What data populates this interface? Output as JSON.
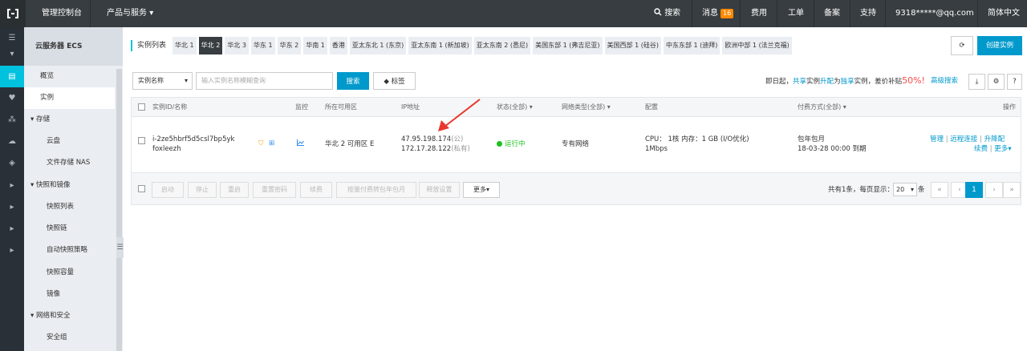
{
  "topbar": {
    "console": "管理控制台",
    "products": "产品与服务",
    "search": "搜索",
    "messages": "消息",
    "message_count": "16",
    "billing": "费用",
    "tickets": "工单",
    "icp": "备案",
    "support": "支持",
    "account": "9318*****@qq.com",
    "language": "简体中文"
  },
  "sidebar": {
    "title": "云服务器 ECS",
    "items": [
      {
        "label": "概览"
      },
      {
        "label": "实例"
      },
      {
        "label": "存储"
      },
      {
        "label": "云盘"
      },
      {
        "label": "文件存储 NAS"
      },
      {
        "label": "快照和镜像"
      },
      {
        "label": "快照列表"
      },
      {
        "label": "快照链"
      },
      {
        "label": "自动快照策略"
      },
      {
        "label": "快照容量"
      },
      {
        "label": "镜像"
      },
      {
        "label": "网络和安全"
      },
      {
        "label": "安全组"
      }
    ]
  },
  "regions": {
    "label": "实例列表",
    "tabs": [
      {
        "label": "华北 1"
      },
      {
        "label": "华北 2"
      },
      {
        "label": "华北 3"
      },
      {
        "label": "华东 1"
      },
      {
        "label": "华东 2"
      },
      {
        "label": "华南 1"
      },
      {
        "label": "香港"
      },
      {
        "label": "亚太东北 1 (东京)"
      },
      {
        "label": "亚太东南 1 (新加坡)"
      },
      {
        "label": "亚太东南 2 (悉尼)"
      },
      {
        "label": "美国东部 1 (弗吉尼亚)"
      },
      {
        "label": "美国西部 1 (硅谷)"
      },
      {
        "label": "中东东部 1 (迪拜)"
      },
      {
        "label": "欧洲中部 1 (法兰克福)"
      }
    ],
    "active_index": 1
  },
  "toolbar": {
    "create": "创建实例"
  },
  "filter": {
    "select_value": "实例名称",
    "search_placeholder": "输入实例名称模糊查询",
    "search_button": "搜索",
    "tag_button": "标签",
    "promo_prefix": "即日起，",
    "promo_share": "共享",
    "promo_mid1": "实例",
    "promo_upgrade": "升配",
    "promo_mid2": "为",
    "promo_exclusive": "独享",
    "promo_mid3": "实例，差价补贴",
    "promo_percent": "50%!",
    "advanced_search": "高级搜索"
  },
  "table": {
    "headers": {
      "id_name": "实例ID/名称",
      "monitor": "监控",
      "zone": "所在可用区",
      "ip": "IP地址",
      "status": "状态(全部)",
      "network": "网络类型(全部)",
      "config": "配置",
      "billing": "付费方式(全部)",
      "actions": "操作"
    },
    "rows": [
      {
        "instance_id": "i-2ze5hbrf5d5csl7bp5yk",
        "name": "foxleezh",
        "zone": "华北 2 可用区 E",
        "public_ip": "47.95.198.174",
        "public_tag": "(公)",
        "private_ip": "172.17.28.122",
        "private_tag": "(私有)",
        "status": "运行中",
        "network": "专有网络",
        "config_line1": "CPU： 1核    内存：1 GB (I/O优化)",
        "config_line2": "1Mbps",
        "billing_type": "包年包月",
        "expiry": "18-03-28 00:00 到期",
        "actions": {
          "manage": "管理",
          "remote": "远程连接",
          "upgrade": "升降配",
          "renew": "续费",
          "more": "更多"
        }
      }
    ],
    "batch": {
      "start": "启动",
      "stop": "停止",
      "restart": "重启",
      "reset_password": "重置密码",
      "renew": "续费",
      "convert": "按量付费转包年包月",
      "release": "释放设置",
      "more": "更多"
    }
  },
  "pagination": {
    "total": "共有1条，",
    "per_page_label": "每页显示：",
    "per_page_value": "20",
    "unit": "条",
    "first": "«",
    "prev": "‹",
    "current": "1",
    "next": "›",
    "last": "»"
  },
  "colors": {
    "topbar": "#373d41",
    "accent": "#00c1de",
    "primary_button": "#0099cc",
    "running": "#1dc11d",
    "promo_highlight": "#f54b4b",
    "annotation_arrow": "#e8382e"
  },
  "icons": {
    "logo": "aliyun-logo-icon",
    "search": "search-icon",
    "refresh": "refresh-icon",
    "download": "download-icon",
    "settings": "gear-icon",
    "help": "help-icon",
    "monitor": "chart-icon"
  }
}
